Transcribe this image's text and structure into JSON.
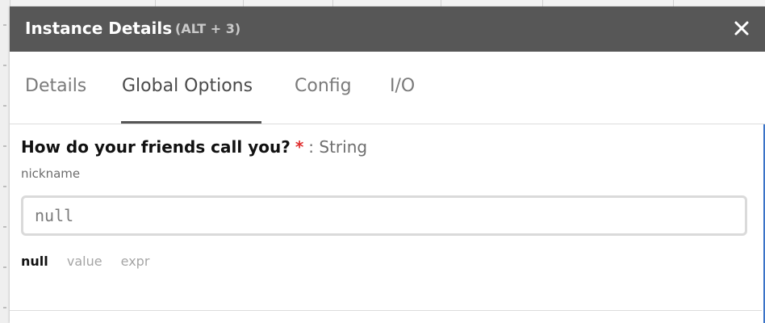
{
  "window": {
    "title": "Instance Details",
    "shortcut": "(ALT + 3)"
  },
  "tabs": [
    {
      "label": "Details",
      "active": false
    },
    {
      "label": "Global Options",
      "active": true
    },
    {
      "label": "Config",
      "active": false
    },
    {
      "label": "I/O",
      "active": false
    }
  ],
  "field": {
    "question": "How do your friends call you?",
    "required_marker": "*",
    "type": ": String",
    "key": "nickname",
    "input_value": "null",
    "modes": [
      {
        "label": "null",
        "active": true
      },
      {
        "label": "value",
        "active": false
      },
      {
        "label": "expr",
        "active": false
      }
    ]
  },
  "colors": {
    "header_bg": "#575757",
    "accent": "#3b73c7",
    "required": "#e03030"
  },
  "icons": {
    "close": "close-icon"
  }
}
